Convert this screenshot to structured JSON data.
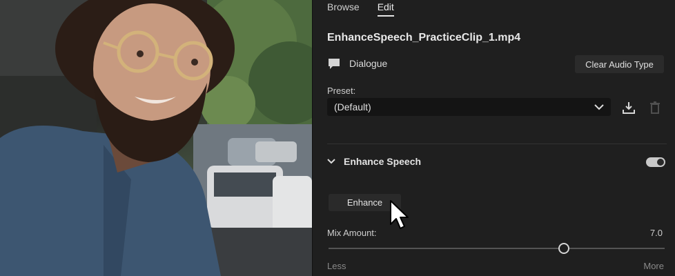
{
  "tabs": [
    {
      "label": "Browse",
      "active": false
    },
    {
      "label": "Edit",
      "active": true
    }
  ],
  "clip": {
    "filename": "EnhanceSpeech_PracticeClip_1.mp4"
  },
  "audio_type": {
    "label": "Dialogue",
    "icon": "speech-bubble-icon",
    "clear_label": "Clear Audio Type"
  },
  "preset": {
    "label": "Preset:",
    "value": "(Default)"
  },
  "enhance_section": {
    "title": "Enhance Speech",
    "enabled": true,
    "button_label": "Enhance",
    "mix": {
      "label": "Mix Amount:",
      "value": "7.0",
      "fraction": 0.7,
      "min_label": "Less",
      "max_label": "More"
    }
  },
  "colors": {
    "panel_bg": "#1f1f1f",
    "field_bg": "#141414",
    "button_bg": "#2b2b2b"
  }
}
